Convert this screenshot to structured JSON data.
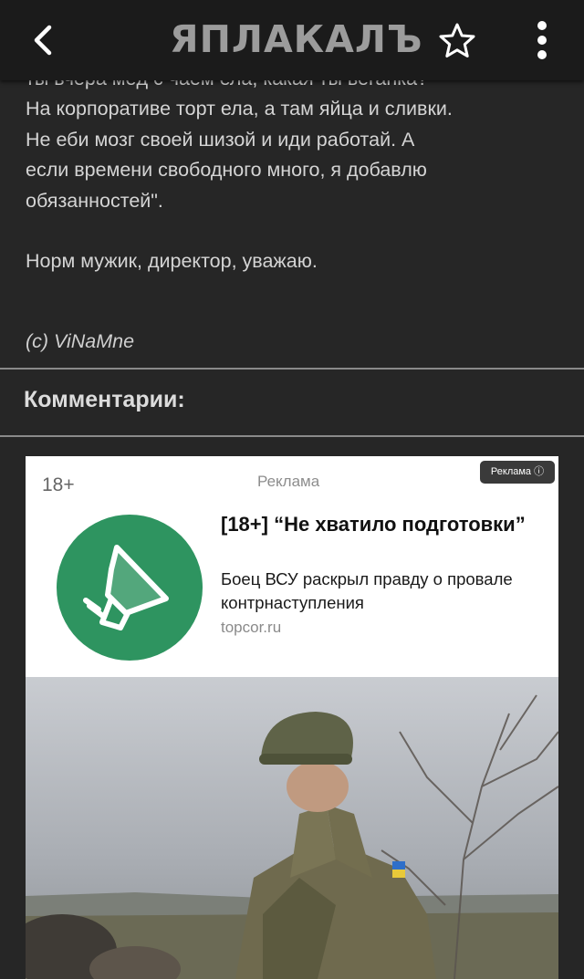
{
  "header": {
    "logo_text": "ЯПЛАКАЛЪ",
    "back_icon": "chevron-left-icon",
    "favorite_icon": "star-icon",
    "menu_icon": "more-vert-icon"
  },
  "post": {
    "cut_line": "ты вчера мёд с чаем ела, какая ты веганка?",
    "lines": [
      "На корпоративе торт ела, а там яйца и сливки.",
      "Не еби мозг своей шизой и иди работай. А",
      "если времени свободного много, я добавлю",
      "обязанностей\"."
    ],
    "closing": "Норм мужик, директор, уважаю.",
    "signature": "(c) ViNaMne"
  },
  "comments": {
    "title": "Комментарии:"
  },
  "ad": {
    "age": "18+",
    "label": "Реклама",
    "badge": "Реклама ⓘ",
    "title": "[18+] “Не хватило подготовки”",
    "description": "Боец ВСУ раскрыл правду о провале контрнаступления",
    "domain": "topcor.ru",
    "logo_icon": "megaphone-icon",
    "colors": {
      "logo_bg": "#2e9460",
      "card_bg": "#ffffff"
    }
  },
  "colors": {
    "background": "#262626",
    "topbar": "#1b1b1b",
    "text": "#d4d4d4"
  }
}
